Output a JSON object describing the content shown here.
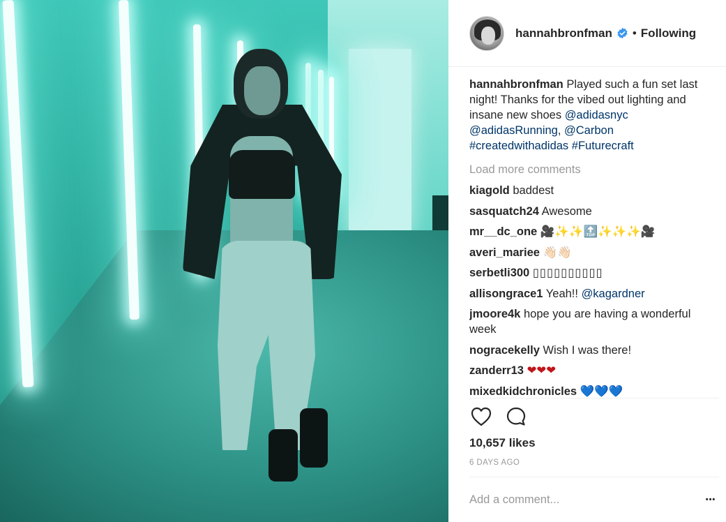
{
  "post": {
    "username": "hannahbronfman",
    "verified": true,
    "separator": "•",
    "follow_state": "Following",
    "caption": {
      "username": "hannahbronfman",
      "text": " Played such a fun set last night! Thanks for the vibed out lighting and insane new shoes ",
      "mention1": "@adidasnyc",
      "mention2": "@adidasRunning",
      "sep": ", ",
      "mention3": "@Carbon",
      "hashtag1": "#createdwithadidas",
      "hashtag2": "#Futurecraft"
    },
    "load_more": "Load more comments",
    "comments": [
      {
        "user": "kiagold",
        "text": "baddest"
      },
      {
        "user": "sasquatch24",
        "text": "Awesome"
      },
      {
        "user": "mr__dc_one",
        "text": "🎥✨✨🔝✨✨✨🎥"
      },
      {
        "user": "averi_mariee",
        "text": "👋🏻👋🏻"
      },
      {
        "user": "serbetli300",
        "text": "▯▯▯▯▯▯▯▯▯▯"
      },
      {
        "user": "allisongrace1",
        "text": "Yeah!! ",
        "mention": "@kagardner"
      },
      {
        "user": "jmoore4k",
        "text": "hope you are having a wonderful week"
      },
      {
        "user": "nogracekelly",
        "text": "Wish I was there!"
      },
      {
        "user": "zanderr13",
        "text": "❤❤❤"
      },
      {
        "user": "mixedkidchronicles",
        "text": "💙💙💙"
      }
    ],
    "likes": "10,657 likes",
    "timestamp": "6 DAYS AGO",
    "add_comment_placeholder": "Add a comment...",
    "more_label": "•••",
    "icons": {
      "like": "heart-icon",
      "comment": "comment-bubble-icon",
      "verified": "verified-badge-icon"
    },
    "colors": {
      "link": "#003569",
      "verified": "#3897f0",
      "muted": "#999999",
      "zanderr13_hearts": "#c0151a",
      "mixed_hearts": "#18b6c9"
    }
  }
}
